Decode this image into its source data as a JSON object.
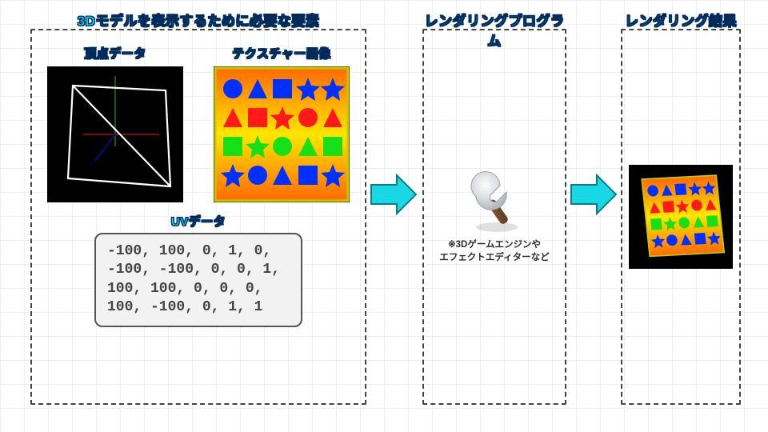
{
  "titles": {
    "p1": "3Dモデルを表示するために必要な要素",
    "p2": "レンダリングプログラム",
    "p3": "レンダリング結果"
  },
  "labels": {
    "vertex": "頂点データ",
    "texture": "テクスチャー画像",
    "uv": "UVデータ"
  },
  "footnote": "※3Dゲームエンジンや\nエフェクトエディターなど",
  "uv_text": "-100, 100, 0, 1, 0,\n-100, -100, 0, 0, 1,\n100, 100, 0, 0, 0,\n100, -100, 0, 1, 1",
  "texture_palette": {
    "shapes_row1": "#0030ff",
    "shapes_row2": "#ff1a1a",
    "shapes_row3": "#16e016",
    "shapes_row4": "#0030ff",
    "grad_top": "#ff6a00",
    "grad_mid": "#ffe600",
    "grad_bot": "#ff6a00",
    "border": "#c8c800"
  }
}
